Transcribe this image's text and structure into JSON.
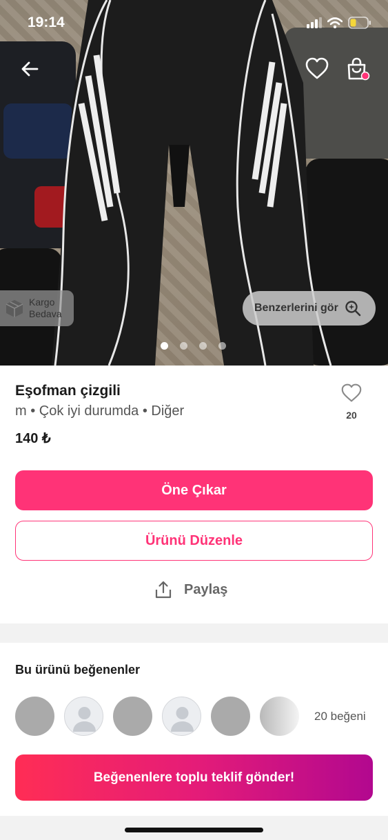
{
  "status_bar": {
    "time": "19:14",
    "battery_color": "#f5d73a"
  },
  "photo": {
    "shipping_badge": {
      "line1": "Kargo",
      "line2": "Bedava"
    },
    "similar_button": {
      "label": "Benzerlerini gör"
    },
    "pager": {
      "total": 4,
      "active_index": 0
    }
  },
  "product": {
    "title": "Eşofman çizgili",
    "meta": "m • Çok iyi durumda • Diğer",
    "price": "140 ₺",
    "like_count": "20"
  },
  "actions": {
    "promote_label": "Öne Çıkar",
    "edit_label": "Ürünü Düzenle",
    "share_label": "Paylaş"
  },
  "likers": {
    "title": "Bu ürünü beğenenler",
    "count_label": "20 beğeni",
    "avatars": [
      "photo",
      "placeholder",
      "photo",
      "placeholder",
      "photo",
      "photo-fade"
    ],
    "bulk_offer_label": "Beğenenlere toplu teklif gönder!"
  },
  "colors": {
    "accent": "#ff3377",
    "gradient_start": "#ff2d55",
    "gradient_end": "#b2088f"
  },
  "icons": [
    "arrow-left-icon",
    "heart-icon",
    "shopping-bag-icon",
    "box-icon",
    "search-sparkle-icon",
    "share-icon",
    "person-placeholder-icon"
  ]
}
